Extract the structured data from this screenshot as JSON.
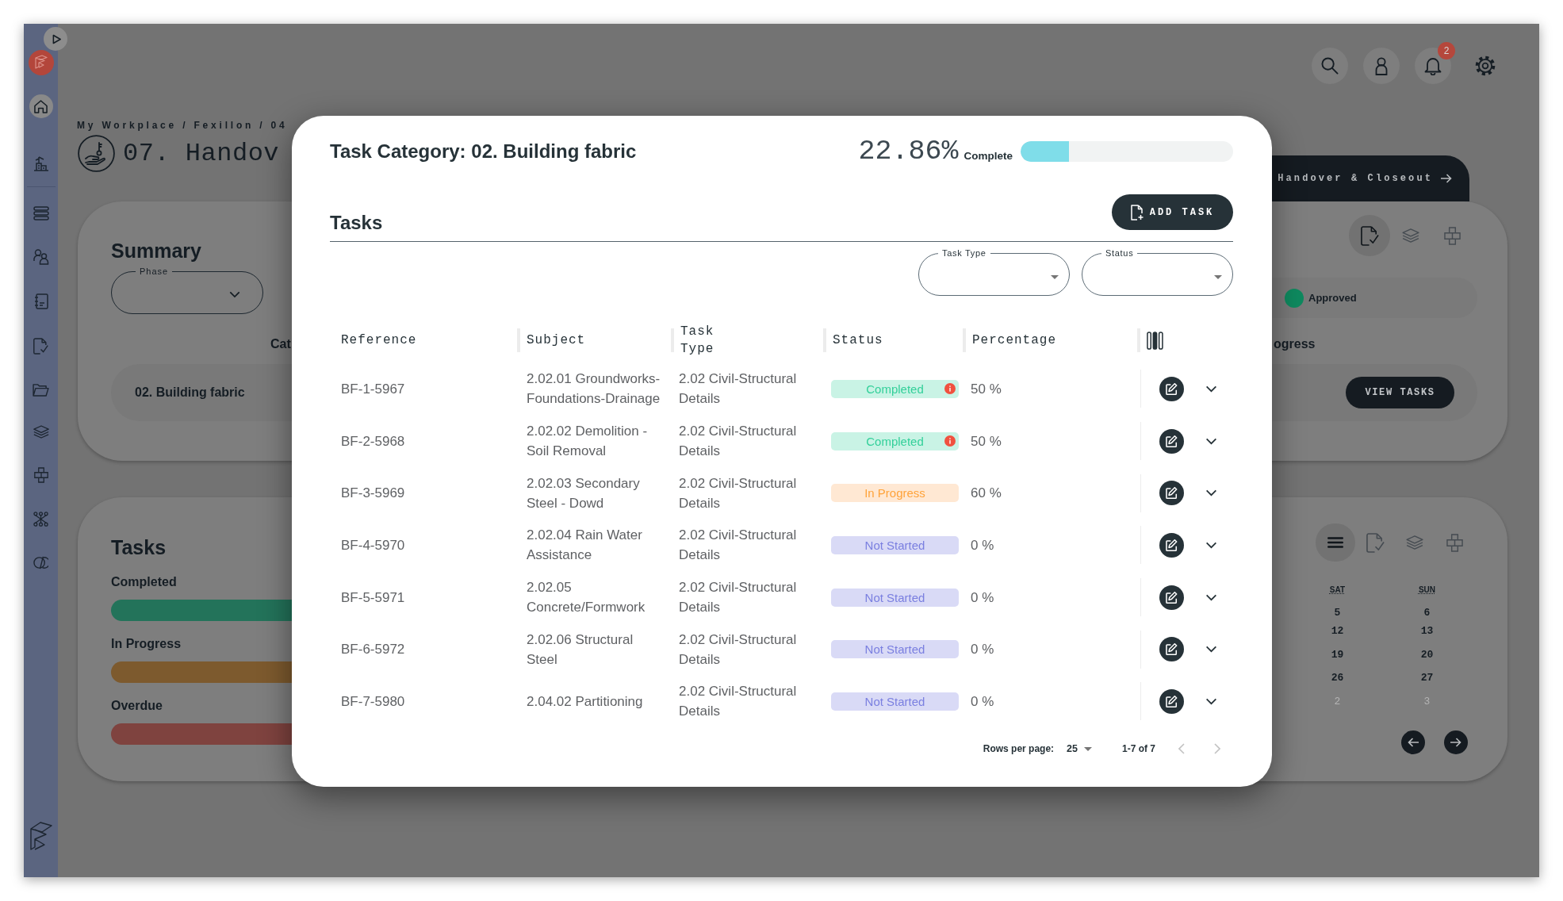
{
  "top_bar": {
    "notification_count": "2"
  },
  "header": {
    "breadcrumb": "My Workplace / Fexillon / 04",
    "title": "07. Handov",
    "phase_tab": "Handover & Closeout"
  },
  "summary": {
    "title": "Summary",
    "phase_field": {
      "label": "Phase"
    },
    "views": [
      {
        "kind": "checklist",
        "selected": true
      },
      {
        "kind": "layers",
        "selected": false
      },
      {
        "kind": "blocks",
        "selected": false
      }
    ],
    "status": {
      "label": "Approved",
      "color": "#0e8a5f"
    },
    "columns": [
      "Cat",
      "ogress"
    ],
    "row": {
      "category": "02. Building fabric",
      "button": "VIEW TASKS"
    }
  },
  "tasks_panel": {
    "title": "Tasks",
    "bars": [
      {
        "label": "Completed",
        "color": "#23735a"
      },
      {
        "label": "In Progress",
        "color": "#7d5a2e"
      },
      {
        "label": "Overdue",
        "color": "#7f433f"
      }
    ],
    "views": [
      {
        "kind": "list",
        "selected": true
      },
      {
        "kind": "checklist",
        "selected": false
      },
      {
        "kind": "layers",
        "selected": false
      },
      {
        "kind": "blocks",
        "selected": false
      }
    ],
    "calendar": {
      "days": [
        "SAT",
        "SUN"
      ],
      "weeks": [
        [
          {
            "date": "5",
            "muted": false
          },
          {
            "date": "6",
            "muted": false
          }
        ],
        [
          {
            "date": "12",
            "muted": false
          },
          {
            "date": "13",
            "muted": false
          }
        ],
        [
          {
            "date": "19",
            "muted": false
          },
          {
            "date": "20",
            "muted": false
          }
        ],
        [
          {
            "date": "26",
            "muted": false
          },
          {
            "date": "27",
            "muted": false
          }
        ],
        [
          {
            "date": "2",
            "muted": true
          },
          {
            "date": "3",
            "muted": true
          }
        ]
      ]
    }
  },
  "modal": {
    "title": "Task Category: 02. Building fabric",
    "progress": {
      "value": "22.86%",
      "label": "Complete",
      "level": 0.2286
    },
    "section": "Tasks",
    "add_button": "ADD TASK",
    "filters": [
      {
        "label": "Task Type"
      },
      {
        "label": "Status"
      }
    ],
    "table": {
      "columns": [
        "Reference",
        "Subject",
        "Task Type",
        "Status",
        "Percentage"
      ],
      "rows": [
        {
          "reference": "BF-1-5967",
          "subject": "2.02.01 Groundworks-Foundations-Drainage",
          "task_type": "2.02 Civil-Structural Details",
          "status": {
            "label": "Completed",
            "kind": "completed"
          },
          "flagged": true,
          "percentage": "50 %",
          "expanded": false
        },
        {
          "reference": "BF-2-5968",
          "subject": "2.02.02 Demolition - Soil Removal",
          "task_type": "2.02 Civil-Structural Details",
          "status": {
            "label": "Completed",
            "kind": "completed"
          },
          "flagged": true,
          "percentage": "50 %",
          "expanded": false
        },
        {
          "reference": "BF-3-5969",
          "subject": "2.02.03 Secondary Steel - Dowd",
          "task_type": "2.02 Civil-Structural Details",
          "status": {
            "label": "In Progress",
            "kind": "in_progress"
          },
          "flagged": false,
          "percentage": "60 %",
          "expanded": false
        },
        {
          "reference": "BF-4-5970",
          "subject": "2.02.04 Rain Water Assistance",
          "task_type": "2.02 Civil-Structural Details",
          "status": {
            "label": "Not Started",
            "kind": "not_started"
          },
          "flagged": false,
          "percentage": "0 %",
          "expanded": false
        },
        {
          "reference": "BF-5-5971",
          "subject": "2.02.05 Concrete/Formwork",
          "task_type": "2.02 Civil-Structural Details",
          "status": {
            "label": "Not Started",
            "kind": "not_started"
          },
          "flagged": false,
          "percentage": "0 %",
          "expanded": false
        },
        {
          "reference": "BF-6-5972",
          "subject": "2.02.06 Structural Steel",
          "task_type": "2.02 Civil-Structural Details",
          "status": {
            "label": "Not Started",
            "kind": "not_started"
          },
          "flagged": false,
          "percentage": "0 %",
          "expanded": false
        },
        {
          "reference": "BF-7-5980",
          "subject": "2.04.02 Partitioning",
          "task_type": "2.02 Civil-Structural Details",
          "status": {
            "label": "Not Started",
            "kind": "not_started"
          },
          "flagged": false,
          "percentage": "0 %",
          "expanded": false
        }
      ]
    },
    "pagination": {
      "rows_per_page_label": "Rows per page:",
      "rows_per_page": "25",
      "range": "1-7 of 7",
      "previous": {
        "disabled": true
      },
      "next": {
        "disabled": true
      }
    }
  }
}
